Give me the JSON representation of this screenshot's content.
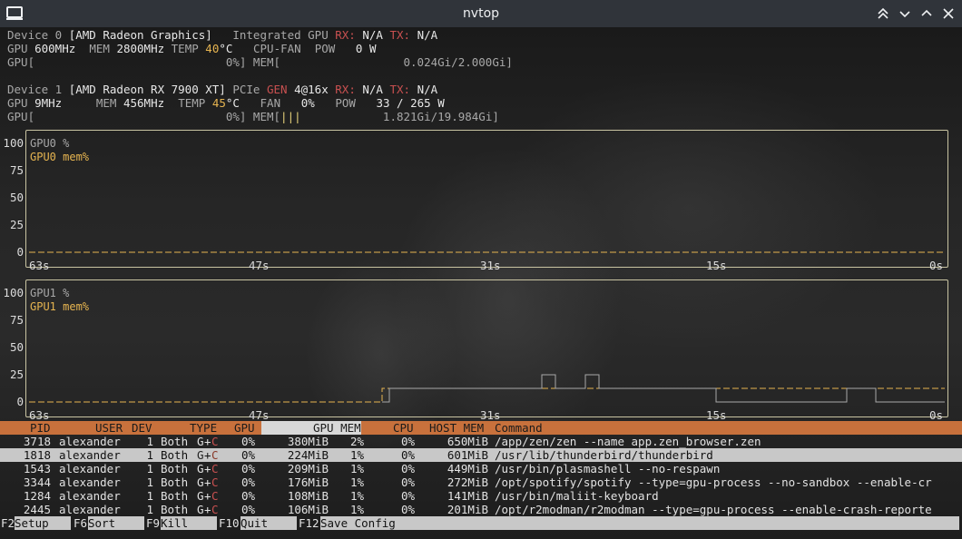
{
  "window": {
    "title": "nvtop",
    "controls": [
      "shade-up",
      "minimize",
      "maximize",
      "close"
    ]
  },
  "devices": [
    {
      "l1_prefix": "Device 0 ",
      "l1_name": "[AMD Radeon Graphics]",
      "l1_integrated": "Integrated GPU",
      "l1_rx_label": "RX:",
      "l1_rx": " N/A ",
      "l1_tx_label": "TX:",
      "l1_tx": " N/A",
      "l2_gpu_label": "GPU ",
      "l2_gpu_clock": "600MHz",
      "l2_mem_label": "MEM ",
      "l2_mem_clock": "2800MHz",
      "l2_temp_label": "TEMP ",
      "l2_temp": "40",
      "l2_temp_unit": "°C",
      "l2_fan_label": "CPU-FAN",
      "l2_fan": "",
      "l2_pow_label": "POW",
      "l2_pow": "0 W",
      "l3_gpu": "GPU[                            0%]",
      "l3_mem": " MEM[                  0.024Gi/2.000Gi]"
    },
    {
      "l1_prefix": "Device 1 ",
      "l1_name": "[AMD Radeon RX 7900 XT]",
      "l1_pcie": "PCIe ",
      "l1_gen_label": "GEN",
      "l1_gen": " 4@16x ",
      "l1_rx_label": "RX:",
      "l1_rx": " N/A ",
      "l1_tx_label": "TX:",
      "l1_tx": " N/A",
      "l2_gpu_label": "GPU ",
      "l2_gpu_clock": "9MHz",
      "l2_mem_label": "MEM ",
      "l2_mem_clock": "456MHz",
      "l2_temp_label": "TEMP ",
      "l2_temp": "45",
      "l2_temp_unit": "°C",
      "l2_fan_label": "FAN",
      "l2_fan": "0%",
      "l2_pow_label": "POW",
      "l2_pow": "33 / 265 W",
      "l3_gpu": "GPU[                            0%]",
      "l3_mem_a": " MEM[",
      "l3_mem_bar": "|||",
      "l3_mem_b": "            1.821Gi/19.984Gi]"
    }
  ],
  "graphs": [
    {
      "series_gpu": "GPU0 %",
      "series_mem": "GPU0 mem%",
      "y_ticks": [
        "100",
        "75",
        "50",
        "25",
        "0"
      ],
      "x_ticks": [
        "63s",
        "47s",
        "31s",
        "15s",
        "0s"
      ]
    },
    {
      "series_gpu": "GPU1 %",
      "series_mem": "GPU1 mem%",
      "y_ticks": [
        "100",
        "75",
        "50",
        "25",
        "0"
      ],
      "x_ticks": [
        "63s",
        "47s",
        "31s",
        "15s",
        "0s"
      ]
    }
  ],
  "colors": {
    "mem_line": "#e6b450",
    "gpu_line": "#a8a8a8",
    "header_bg": "#c8713c",
    "selected_bg": "#c8c8c8"
  },
  "process_header": {
    "pid": "PID",
    "user": "USER",
    "dev": "DEV",
    "type": "TYPE",
    "gpu": "GPU",
    "gpu_mem": "GPU MEM",
    "cpu": "CPU",
    "host_mem": "HOST MEM",
    "command": "Command"
  },
  "processes": [
    {
      "pid": "3718",
      "user": "alexander",
      "dev": "1",
      "type": "Both",
      "g": "G",
      "plus": "+",
      "c": "C",
      "gpu": "0%",
      "gpu_mem": "380MiB",
      "gpu_mem_pct": "2%",
      "cpu": "0%",
      "host_mem": "650MiB",
      "command": "/app/zen/zen --name app.zen_browser.zen"
    },
    {
      "pid": "1818",
      "user": "alexander",
      "dev": "1",
      "type": "Both",
      "g": "G",
      "plus": "+",
      "c": "C",
      "gpu": "0%",
      "gpu_mem": "224MiB",
      "gpu_mem_pct": "1%",
      "cpu": "0%",
      "host_mem": "601MiB",
      "command": "/usr/lib/thunderbird/thunderbird"
    },
    {
      "pid": "1543",
      "user": "alexander",
      "dev": "1",
      "type": "Both",
      "g": "G",
      "plus": "+",
      "c": "C",
      "gpu": "0%",
      "gpu_mem": "209MiB",
      "gpu_mem_pct": "1%",
      "cpu": "0%",
      "host_mem": "449MiB",
      "command": "/usr/bin/plasmashell --no-respawn"
    },
    {
      "pid": "3344",
      "user": "alexander",
      "dev": "1",
      "type": "Both",
      "g": "G",
      "plus": "+",
      "c": "C",
      "gpu": "0%",
      "gpu_mem": "176MiB",
      "gpu_mem_pct": "1%",
      "cpu": "0%",
      "host_mem": "272MiB",
      "command": "/opt/spotify/spotify --type=gpu-process --no-sandbox --enable-cr"
    },
    {
      "pid": "1284",
      "user": "alexander",
      "dev": "1",
      "type": "Both",
      "g": "G",
      "plus": "+",
      "c": "C",
      "gpu": "0%",
      "gpu_mem": "108MiB",
      "gpu_mem_pct": "1%",
      "cpu": "0%",
      "host_mem": "141MiB",
      "command": "/usr/bin/maliit-keyboard"
    },
    {
      "pid": "2445",
      "user": "alexander",
      "dev": "1",
      "type": "Both",
      "g": "G",
      "plus": "+",
      "c": "C",
      "gpu": "0%",
      "gpu_mem": "106MiB",
      "gpu_mem_pct": "1%",
      "cpu": "0%",
      "host_mem": "201MiB",
      "command": "/opt/r2modman/r2modman --type=gpu-process --enable-crash-reporte"
    }
  ],
  "selected_row": 1,
  "fkeys": [
    {
      "key": "F2",
      "action": "Setup"
    },
    {
      "key": "F6",
      "action": "Sort"
    },
    {
      "key": "F9",
      "action": "Kill"
    },
    {
      "key": "F10",
      "action": "Quit"
    },
    {
      "key": "F12",
      "action": "Save Config"
    }
  ]
}
